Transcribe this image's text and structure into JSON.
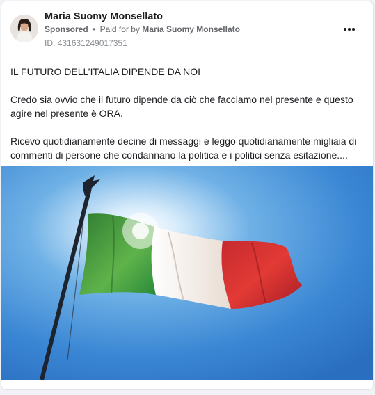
{
  "post": {
    "author_name": "Maria Suomy Monsellato",
    "sponsored_label": "Sponsored",
    "separator": "•",
    "paid_for_prefix": "Paid for by",
    "paid_for_name": "Maria Suomy Monsellato",
    "ad_id": "ID: 431631249017351",
    "paragraphs": [
      "IL FUTURO DELL’ITALIA DIPENDE DA NOI",
      "Credo sia ovvio che il futuro dipende da ciò che facciamo nel presente e questo agire nel presente è ORA.",
      "Ricevo quotidianamente decine di messaggi e leggo quotidianamente migliaia di commenti di persone che condannano la politica e i politici senza esitazione...."
    ],
    "image": {
      "description_icon": "italian-flag-icon",
      "flag_colors": [
        "#2f8f3a",
        "#f1ede6",
        "#cc2630"
      ],
      "sky_color": "#3a86d4"
    }
  },
  "icons": {
    "more_options": "more-options-icon",
    "avatar": "avatar"
  }
}
